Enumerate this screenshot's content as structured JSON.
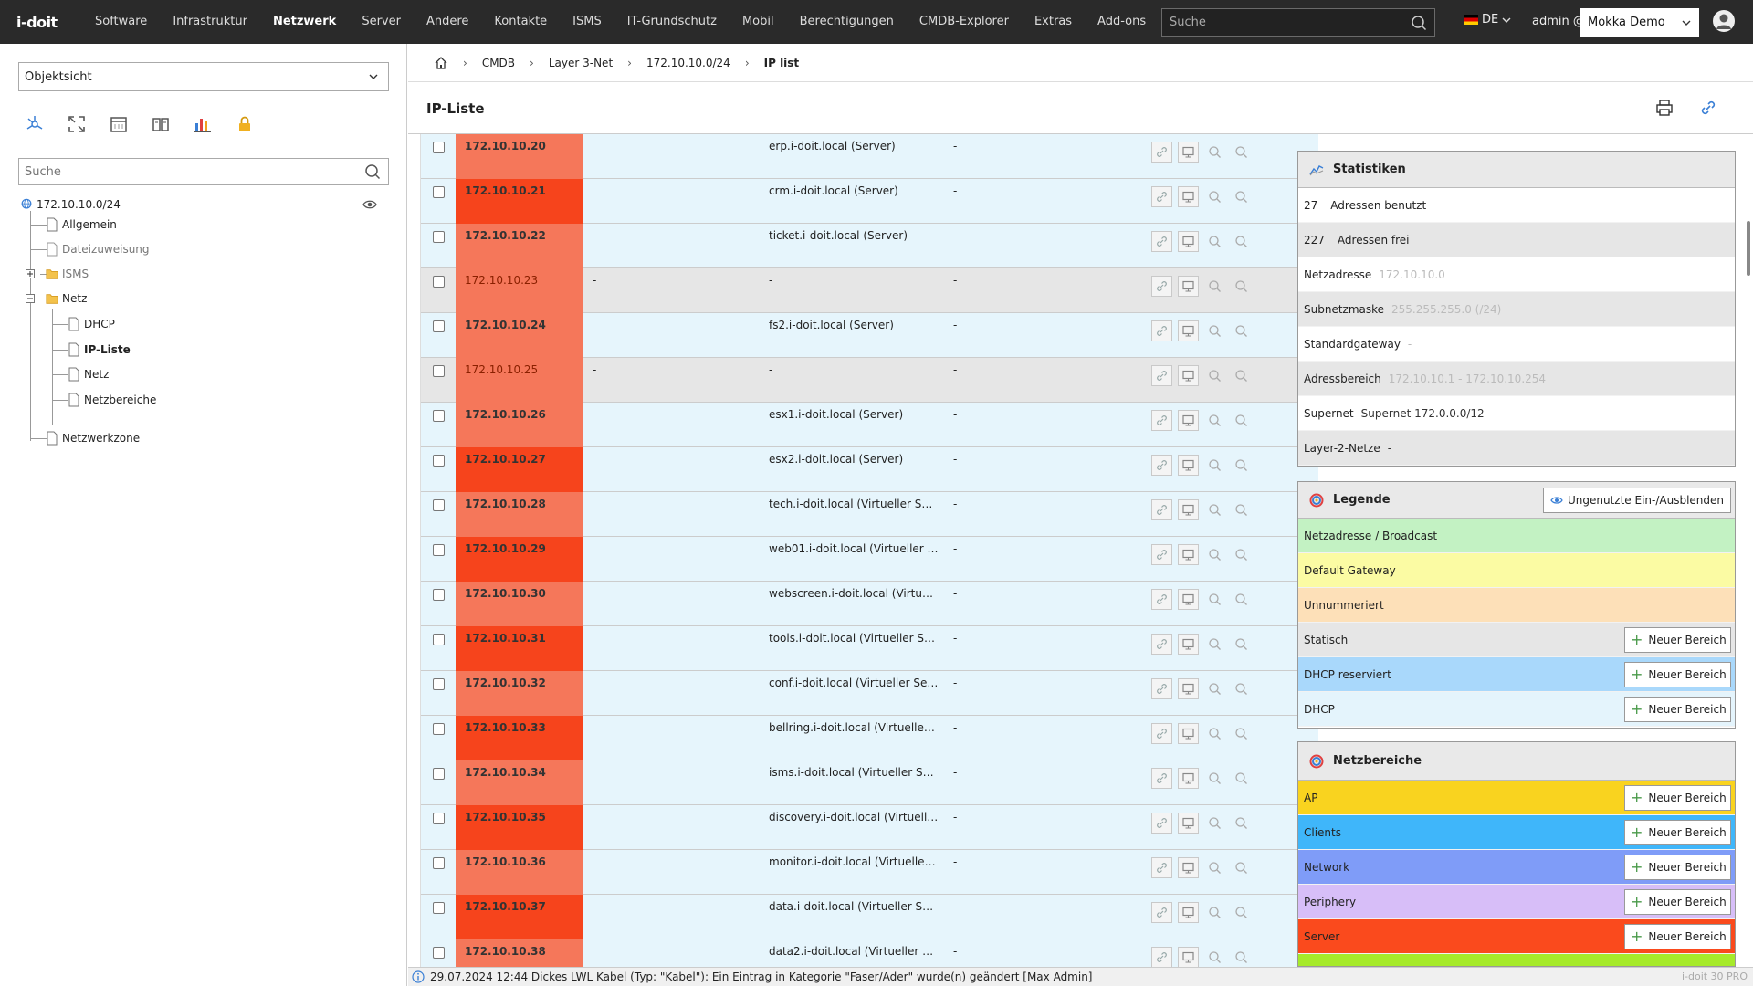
{
  "topbar": {
    "logo": "i-doit",
    "nav": [
      "Software",
      "Infrastruktur",
      "Netzwerk",
      "Server",
      "Andere",
      "Kontakte",
      "ISMS",
      "IT-Grundschutz",
      "Mobil",
      "Berechtigungen",
      "CMDB-Explorer",
      "Extras",
      "Add-ons"
    ],
    "active_nav": "Netzwerk",
    "search_placeholder": "Suche",
    "language": "DE",
    "user": "admin @",
    "tenant": "Mokka Demo"
  },
  "sidebar": {
    "view_select": "Objektsicht",
    "search_placeholder": "Suche",
    "tree": {
      "root": "172.10.10.0/24",
      "allgemein": "Allgemein",
      "dateizuweisung": "Dateizuweisung",
      "isms": "ISMS",
      "netz_folder": "Netz",
      "dhcp": "DHCP",
      "ipliste": "IP-Liste",
      "netz": "Netz",
      "netzbereiche": "Netzbereiche",
      "netzwerkzone": "Netzwerkzone"
    }
  },
  "breadcrumb": [
    "CMDB",
    "Layer 3-Net",
    "172.10.10.0/24",
    "IP list"
  ],
  "page_title": "IP-Liste",
  "ip_rows": [
    {
      "ip": "172.10.10.20",
      "col2": "",
      "host": "erp.i-doit.local (Server)",
      "dash": "-",
      "used": true
    },
    {
      "ip": "172.10.10.21",
      "col2": "",
      "host": "crm.i-doit.local (Server)",
      "dash": "-",
      "used": true
    },
    {
      "ip": "172.10.10.22",
      "col2": "",
      "host": "ticket.i-doit.local (Server)",
      "dash": "-",
      "used": true
    },
    {
      "ip": "172.10.10.23",
      "col2": "-",
      "host": "-",
      "dash": "-",
      "used": false
    },
    {
      "ip": "172.10.10.24",
      "col2": "",
      "host": "fs2.i-doit.local (Server)",
      "dash": "-",
      "used": true
    },
    {
      "ip": "172.10.10.25",
      "col2": "-",
      "host": "-",
      "dash": "-",
      "used": false
    },
    {
      "ip": "172.10.10.26",
      "col2": "",
      "host": "esx1.i-doit.local (Server)",
      "dash": "-",
      "used": true
    },
    {
      "ip": "172.10.10.27",
      "col2": "",
      "host": "esx2.i-doit.local (Server)",
      "dash": "-",
      "used": true
    },
    {
      "ip": "172.10.10.28",
      "col2": "",
      "host": "tech.i-doit.local (Virtueller Serv...",
      "dash": "-",
      "used": true
    },
    {
      "ip": "172.10.10.29",
      "col2": "",
      "host": "web01.i-doit.local (Virtueller Se...",
      "dash": "-",
      "used": true
    },
    {
      "ip": "172.10.10.30",
      "col2": "",
      "host": "webscreen.i-doit.local (Virtuelle...",
      "dash": "-",
      "used": true
    },
    {
      "ip": "172.10.10.31",
      "col2": "",
      "host": "tools.i-doit.local (Virtueller Serv...",
      "dash": "-",
      "used": true
    },
    {
      "ip": "172.10.10.32",
      "col2": "",
      "host": "conf.i-doit.local (Virtueller Server)",
      "dash": "-",
      "used": true
    },
    {
      "ip": "172.10.10.33",
      "col2": "",
      "host": "bellring.i-doit.local (Virtueller Se...",
      "dash": "-",
      "used": true
    },
    {
      "ip": "172.10.10.34",
      "col2": "",
      "host": "isms.i-doit.local (Virtueller Server)",
      "dash": "-",
      "used": true
    },
    {
      "ip": "172.10.10.35",
      "col2": "",
      "host": "discovery.i-doit.local (Virtueller ...",
      "dash": "-",
      "used": true
    },
    {
      "ip": "172.10.10.36",
      "col2": "",
      "host": "monitor.i-doit.local (Virtueller S...",
      "dash": "-",
      "used": true
    },
    {
      "ip": "172.10.10.37",
      "col2": "",
      "host": "data.i-doit.local (Virtueller Serv...",
      "dash": "-",
      "used": true
    },
    {
      "ip": "172.10.10.38",
      "col2": "",
      "host": "data2.i-doit.local (Virtueller Ser...",
      "dash": "-",
      "used": true
    }
  ],
  "statistics": {
    "title": "Statistiken",
    "used_count": "27",
    "used_label": "Adressen benutzt",
    "free_count": "227",
    "free_label": "Adressen frei",
    "rows": [
      {
        "k": "Netzadresse",
        "v": "172.10.10.0",
        "dim": true
      },
      {
        "k": "Subnetzmaske",
        "v": "255.255.255.0 (/24)",
        "dim": true
      },
      {
        "k": "Standardgateway",
        "v": "-",
        "dim": true
      },
      {
        "k": "Adressbereich",
        "v": "172.10.10.1 - 172.10.10.254",
        "dim": true
      },
      {
        "k": "Supernet",
        "v": "Supernet 172.0.0.0/12",
        "dim": false
      },
      {
        "k": "Layer-2-Netze",
        "v": "-",
        "dim": false
      }
    ]
  },
  "legend": {
    "title": "Legende",
    "toggle_label": "Ungenutzte Ein-/Ausblenden",
    "new_label": "Neuer Bereich",
    "items": [
      {
        "label": "Netzadresse / Broadcast",
        "color": "#c3f2c3",
        "btn": false
      },
      {
        "label": "Default Gateway",
        "color": "#fbfba3",
        "btn": false
      },
      {
        "label": "Unnummeriert",
        "color": "#fde0b8",
        "btn": false
      },
      {
        "label": "Statisch",
        "color": "#e6e6e6",
        "btn": true
      },
      {
        "label": "DHCP reserviert",
        "color": "#a9d8fb",
        "btn": true
      },
      {
        "label": "DHCP",
        "color": "#e4f4fc",
        "btn": true
      }
    ]
  },
  "netzbereiche": {
    "title": "Netzbereiche",
    "new_label": "Neuer Bereich",
    "items": [
      {
        "label": "AP",
        "color": "#f9d31f"
      },
      {
        "label": "Clients",
        "color": "#3fb6fa"
      },
      {
        "label": "Network",
        "color": "#7f9cf8"
      },
      {
        "label": "Periphery",
        "color": "#d7bef8"
      },
      {
        "label": "Server",
        "color": "#fa4a1d"
      }
    ]
  },
  "colors": {
    "used_ip": "#f6441c",
    "used_ip_alt": "#f5775a",
    "unused_ip": "#f5775a",
    "row_bg": "#e6f5fc",
    "row_unused_bg": "#e6e6e6"
  },
  "statusbar": {
    "message": "29.07.2024 12:44 Dickes LWL Kabel (Typ: \"Kabel\"): Ein Eintrag in Kategorie \"Faser/Ader\" wurde(n) geändert [Max Admin]",
    "version": "i-doit 30 PRO"
  }
}
